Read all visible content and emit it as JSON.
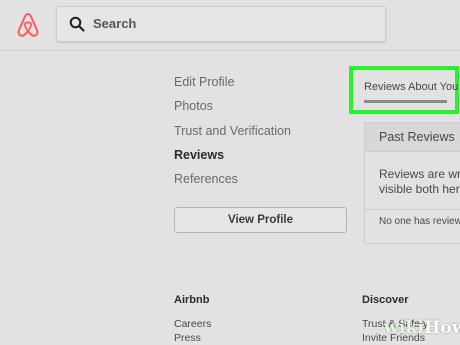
{
  "header": {
    "search": {
      "placeholder": "Search"
    }
  },
  "sidebar": {
    "items": [
      {
        "label": "Edit Profile",
        "active": false
      },
      {
        "label": "Photos",
        "active": false
      },
      {
        "label": "Trust and Verification",
        "active": false
      },
      {
        "label": "Reviews",
        "active": true
      },
      {
        "label": "References",
        "active": false
      }
    ],
    "view_profile_label": "View Profile"
  },
  "tabs": {
    "active_label": "Reviews About You"
  },
  "panel": {
    "title": "Past Reviews",
    "text_line1": "Reviews are wri",
    "text_line2": "visible both her",
    "empty_text": "No one has review"
  },
  "footer": {
    "col1": {
      "heading": "Airbnb",
      "links": [
        "Careers",
        "Press"
      ]
    },
    "col2": {
      "heading": "Discover",
      "links": [
        "Trust & Safety",
        "Invite Friends"
      ]
    }
  },
  "watermark": {
    "part1": "wiki",
    "part2": "How"
  },
  "colors": {
    "highlight": "#2af22a",
    "brand": "#ff5a5f"
  }
}
